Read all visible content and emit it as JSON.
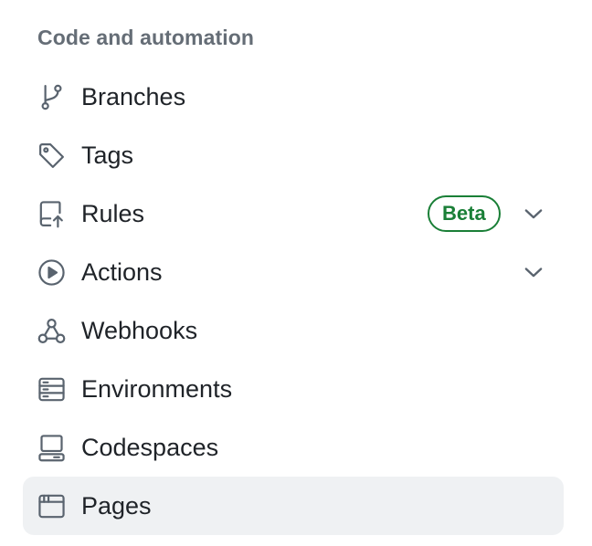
{
  "section": {
    "heading": "Code and automation"
  },
  "nav": {
    "items": [
      {
        "label": "Branches",
        "icon": "git-branch-icon"
      },
      {
        "label": "Tags",
        "icon": "tag-icon"
      },
      {
        "label": "Rules",
        "icon": "repo-push-icon",
        "badge": "Beta",
        "expandable": true
      },
      {
        "label": "Actions",
        "icon": "play-icon",
        "expandable": true
      },
      {
        "label": "Webhooks",
        "icon": "webhook-icon"
      },
      {
        "label": "Environments",
        "icon": "server-icon"
      },
      {
        "label": "Codespaces",
        "icon": "codespaces-icon"
      },
      {
        "label": "Pages",
        "icon": "browser-icon",
        "selected": true
      }
    ]
  },
  "colors": {
    "text": "#1f2328",
    "heading": "#656d76",
    "badge": "#1a7f37",
    "selected_bg": "#eff1f3",
    "icon": "#59636e"
  }
}
